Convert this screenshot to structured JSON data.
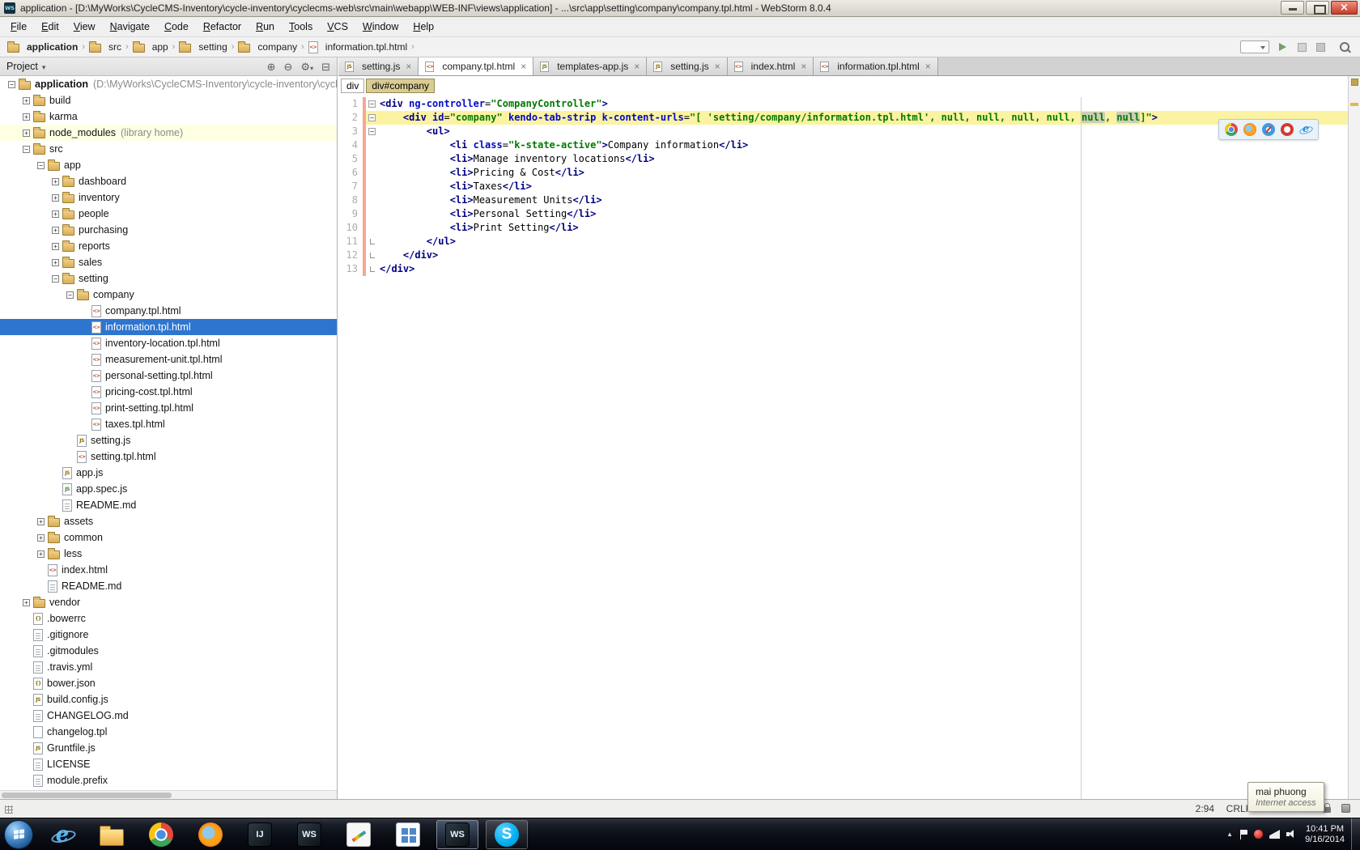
{
  "window": {
    "app_icon_glyph": "WS",
    "title": "application - [D:\\MyWorks\\CycleCMS-Inventory\\cycle-inventory\\cyclecms-web\\src\\main\\webapp\\WEB-INF\\views\\application] - ...\\src\\app\\setting\\company\\company.tpl.html - WebStorm 8.0.4"
  },
  "menu": [
    "File",
    "Edit",
    "View",
    "Navigate",
    "Code",
    "Refactor",
    "Run",
    "Tools",
    "VCS",
    "Window",
    "Help"
  ],
  "breadcrumbs": {
    "items": [
      {
        "label": "application",
        "icon": "folder"
      },
      {
        "label": "src",
        "icon": "folder"
      },
      {
        "label": "app",
        "icon": "folder"
      },
      {
        "label": "setting",
        "icon": "folder"
      },
      {
        "label": "company",
        "icon": "folder"
      },
      {
        "label": "information.tpl.html",
        "icon": "html"
      }
    ]
  },
  "icons": {
    "locate": "⊕",
    "collapse": "⊖",
    "settings": "⚙",
    "hide": "⊟",
    "chevron_up": "▲",
    "project_arrow": "▾"
  },
  "project_panel": {
    "title": "Project",
    "tree": [
      {
        "label": "application",
        "suffix": "(D:\\MyWorks\\CycleCMS-Inventory\\cycle-inventory\\cycle",
        "level": 0,
        "icon": "folder",
        "expander": "minus",
        "bold": true
      },
      {
        "label": "build",
        "level": 1,
        "icon": "folder",
        "expander": "plus"
      },
      {
        "label": "karma",
        "level": 1,
        "icon": "folder",
        "expander": "plus"
      },
      {
        "label": "node_modules",
        "suffix": "(library home)",
        "level": 1,
        "icon": "folder",
        "expander": "plus",
        "library": true
      },
      {
        "label": "src",
        "level": 1,
        "icon": "folder",
        "expander": "minus"
      },
      {
        "label": "app",
        "level": 2,
        "icon": "folder",
        "expander": "minus"
      },
      {
        "label": "dashboard",
        "level": 3,
        "icon": "folder",
        "expander": "plus"
      },
      {
        "label": "inventory",
        "level": 3,
        "icon": "folder",
        "expander": "plus"
      },
      {
        "label": "people",
        "level": 3,
        "icon": "folder",
        "expander": "plus"
      },
      {
        "label": "purchasing",
        "level": 3,
        "icon": "folder",
        "expander": "plus"
      },
      {
        "label": "reports",
        "level": 3,
        "icon": "folder",
        "expander": "plus"
      },
      {
        "label": "sales",
        "level": 3,
        "icon": "folder",
        "expander": "plus"
      },
      {
        "label": "setting",
        "level": 3,
        "icon": "folder",
        "expander": "minus"
      },
      {
        "label": "company",
        "level": 4,
        "icon": "folder",
        "expander": "minus"
      },
      {
        "label": "company.tpl.html",
        "level": 5,
        "icon": "html"
      },
      {
        "label": "information.tpl.html",
        "level": 5,
        "icon": "html",
        "selected": true
      },
      {
        "label": "inventory-location.tpl.html",
        "level": 5,
        "icon": "html"
      },
      {
        "label": "measurement-unit.tpl.html",
        "level": 5,
        "icon": "html"
      },
      {
        "label": "personal-setting.tpl.html",
        "level": 5,
        "icon": "html"
      },
      {
        "label": "pricing-cost.tpl.html",
        "level": 5,
        "icon": "html"
      },
      {
        "label": "print-setting.tpl.html",
        "level": 5,
        "icon": "html"
      },
      {
        "label": "taxes.tpl.html",
        "level": 5,
        "icon": "html"
      },
      {
        "label": "setting.js",
        "level": 4,
        "icon": "js"
      },
      {
        "label": "setting.tpl.html",
        "level": 4,
        "icon": "html"
      },
      {
        "label": "app.js",
        "level": 3,
        "icon": "js"
      },
      {
        "label": "app.spec.js",
        "level": 3,
        "icon": "js-spec"
      },
      {
        "label": "README.md",
        "level": 3,
        "icon": "text"
      },
      {
        "label": "assets",
        "level": 2,
        "icon": "folder",
        "expander": "plus"
      },
      {
        "label": "common",
        "level": 2,
        "icon": "folder",
        "expander": "plus"
      },
      {
        "label": "less",
        "level": 2,
        "icon": "folder",
        "expander": "plus"
      },
      {
        "label": "index.html",
        "level": 2,
        "icon": "html"
      },
      {
        "label": "README.md",
        "level": 2,
        "icon": "text"
      },
      {
        "label": "vendor",
        "level": 1,
        "icon": "folder",
        "expander": "plus"
      },
      {
        "label": ".bowerrc",
        "level": 1,
        "icon": "json"
      },
      {
        "label": ".gitignore",
        "level": 1,
        "icon": "text"
      },
      {
        "label": ".gitmodules",
        "level": 1,
        "icon": "text"
      },
      {
        "label": ".travis.yml",
        "level": 1,
        "icon": "yml"
      },
      {
        "label": "bower.json",
        "level": 1,
        "icon": "json"
      },
      {
        "label": "build.config.js",
        "level": 1,
        "icon": "js"
      },
      {
        "label": "CHANGELOG.md",
        "level": 1,
        "icon": "text"
      },
      {
        "label": "changelog.tpl",
        "level": 1,
        "icon": "tpl"
      },
      {
        "label": "Gruntfile.js",
        "level": 1,
        "icon": "js"
      },
      {
        "label": "LICENSE",
        "level": 1,
        "icon": "text"
      },
      {
        "label": "module.prefix",
        "level": 1,
        "icon": "text"
      }
    ]
  },
  "tabs": [
    {
      "label": "setting.js",
      "icon": "js"
    },
    {
      "label": "company.tpl.html",
      "icon": "html",
      "active": true
    },
    {
      "label": "templates-app.js",
      "icon": "js"
    },
    {
      "label": "setting.js",
      "icon": "js"
    },
    {
      "label": "index.html",
      "icon": "html"
    },
    {
      "label": "information.tpl.html",
      "icon": "html"
    }
  ],
  "editor": {
    "crumbs": [
      {
        "label": "div"
      },
      {
        "label": "div#company",
        "current": true
      }
    ],
    "browser_toolbar": [
      "chrome",
      "firefox",
      "safari",
      "opera",
      "ie"
    ],
    "lines": [
      {
        "n": "1",
        "fold": "start",
        "segs": [
          [
            "tag",
            "<div "
          ],
          [
            "attr",
            "ng-controller"
          ],
          [
            "pln",
            "="
          ],
          [
            "val",
            "\"CompanyController\""
          ],
          [
            "tag",
            ">"
          ]
        ]
      },
      {
        "n": "2",
        "fold": "start",
        "caret": true,
        "segs": [
          [
            "pln",
            "    "
          ],
          [
            "tag",
            "<div "
          ],
          [
            "attr",
            "id"
          ],
          [
            "pln",
            "="
          ],
          [
            "val",
            "\"company\""
          ],
          [
            "pln",
            " "
          ],
          [
            "attr",
            "kendo-tab-strip"
          ],
          [
            "pln",
            " "
          ],
          [
            "attr",
            "k-content-urls"
          ],
          [
            "pln",
            "="
          ],
          [
            "val",
            "\"[ 'setting/company/information.tpl.html', null, null, null, null, "
          ],
          [
            "valh",
            "null"
          ],
          [
            "val",
            ", "
          ],
          [
            "valh",
            "null"
          ],
          [
            "val",
            "]\""
          ],
          [
            "tag",
            ">"
          ]
        ]
      },
      {
        "n": "3",
        "fold": "start",
        "segs": [
          [
            "pln",
            "        "
          ],
          [
            "tag",
            "<ul>"
          ]
        ]
      },
      {
        "n": "4",
        "segs": [
          [
            "pln",
            "            "
          ],
          [
            "tag",
            "<li "
          ],
          [
            "attr",
            "class"
          ],
          [
            "pln",
            "="
          ],
          [
            "val",
            "\"k-state-active\""
          ],
          [
            "tag",
            ">"
          ],
          [
            "txt",
            "Company information"
          ],
          [
            "tag",
            "</li>"
          ]
        ]
      },
      {
        "n": "5",
        "segs": [
          [
            "pln",
            "            "
          ],
          [
            "tag",
            "<li>"
          ],
          [
            "txt",
            "Manage inventory locations"
          ],
          [
            "tag",
            "</li>"
          ]
        ]
      },
      {
        "n": "6",
        "segs": [
          [
            "pln",
            "            "
          ],
          [
            "tag",
            "<li>"
          ],
          [
            "txt",
            "Pricing & Cost"
          ],
          [
            "tag",
            "</li>"
          ]
        ]
      },
      {
        "n": "7",
        "segs": [
          [
            "pln",
            "            "
          ],
          [
            "tag",
            "<li>"
          ],
          [
            "txt",
            "Taxes"
          ],
          [
            "tag",
            "</li>"
          ]
        ]
      },
      {
        "n": "8",
        "segs": [
          [
            "pln",
            "            "
          ],
          [
            "tag",
            "<li>"
          ],
          [
            "txt",
            "Measurement Units"
          ],
          [
            "tag",
            "</li>"
          ]
        ]
      },
      {
        "n": "9",
        "segs": [
          [
            "pln",
            "            "
          ],
          [
            "tag",
            "<li>"
          ],
          [
            "txt",
            "Personal Setting"
          ],
          [
            "tag",
            "</li>"
          ]
        ]
      },
      {
        "n": "10",
        "segs": [
          [
            "pln",
            "            "
          ],
          [
            "tag",
            "<li>"
          ],
          [
            "txt",
            "Print Setting"
          ],
          [
            "tag",
            "</li>"
          ]
        ]
      },
      {
        "n": "11",
        "fold": "end",
        "segs": [
          [
            "pln",
            "        "
          ],
          [
            "tag",
            "</ul>"
          ]
        ]
      },
      {
        "n": "12",
        "fold": "end",
        "segs": [
          [
            "pln",
            "    "
          ],
          [
            "tag",
            "</div>"
          ]
        ]
      },
      {
        "n": "13",
        "fold": "end",
        "segs": [
          [
            "tag",
            "</div>"
          ]
        ]
      }
    ]
  },
  "status_bar": {
    "position": "2:94",
    "line_separator": "CRLF"
  },
  "tooltip": {
    "title": "mai phuong",
    "subtitle": "Internet access"
  },
  "taskbar": {
    "clock_time": "10:41 PM",
    "clock_date": "9/16/2014",
    "apps": [
      {
        "name": "internet-explorer",
        "type": "ie",
        "glyph": "e"
      },
      {
        "name": "windows-explorer",
        "type": "folder"
      },
      {
        "name": "chrome",
        "type": "chrome"
      },
      {
        "name": "firefox",
        "type": "firefox"
      },
      {
        "name": "intellij-idea",
        "type": "dark",
        "glyph": "IJ"
      },
      {
        "name": "webstorm",
        "type": "dark",
        "glyph": "WS"
      },
      {
        "name": "paint-editor",
        "type": "paint"
      },
      {
        "name": "grid-app",
        "type": "grid"
      },
      {
        "name": "webstorm-active",
        "type": "dark",
        "glyph": "WS",
        "active": true,
        "running": true
      },
      {
        "name": "skype",
        "type": "skype",
        "glyph": "S",
        "running": true
      }
    ]
  },
  "colors": {
    "selection_blue": "#2E75CF",
    "caret_line_yellow": "#FBF3A1",
    "library_row_yellow": "#FFFFE3",
    "vcs_changed_marker": "#F2A993",
    "tag_navy": "#000080",
    "attr_blue": "#0009C9",
    "value_green": "#007A00",
    "skype_blue": "#00AFF0"
  }
}
